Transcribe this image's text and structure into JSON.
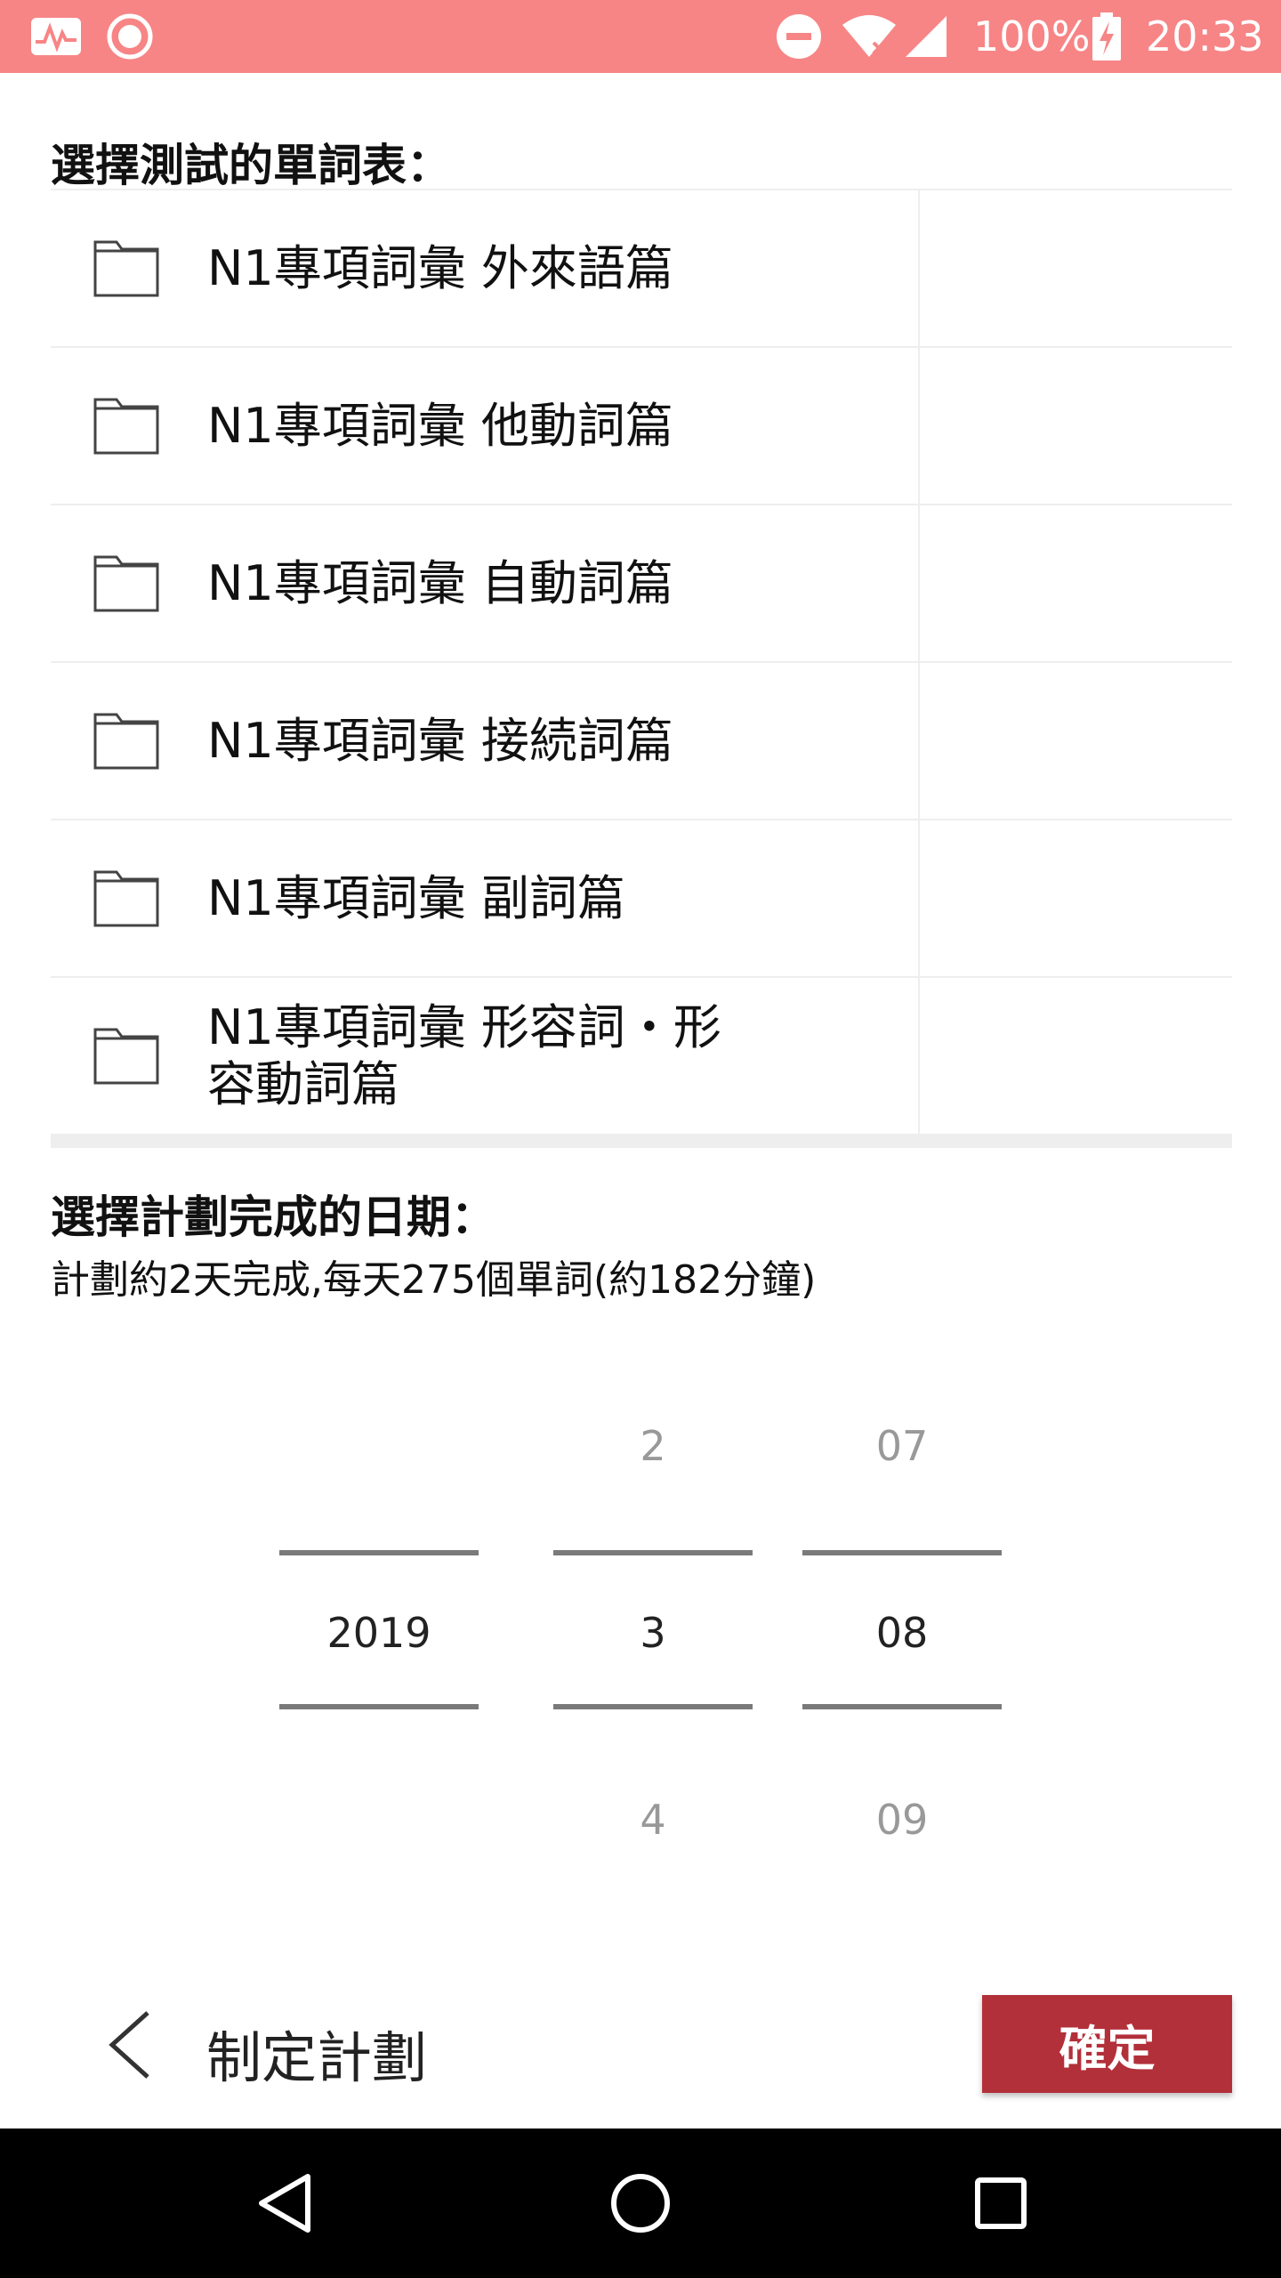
{
  "status_bar": {
    "battery": "100%",
    "time": "20:33",
    "icons": [
      "activity-icon",
      "record-icon",
      "do-not-disturb-icon",
      "wifi-icon",
      "cell-signal-icon",
      "battery-charging-icon"
    ]
  },
  "word_list": {
    "title": "選擇測試的單詞表：",
    "items": [
      {
        "label": "N1專項詞彙 外來語篇",
        "icon": "folder-icon"
      },
      {
        "label": "N1專項詞彙 他動詞篇",
        "icon": "folder-icon"
      },
      {
        "label": "N1專項詞彙 自動詞篇",
        "icon": "folder-icon"
      },
      {
        "label": "N1專項詞彙 接続詞篇",
        "icon": "folder-icon"
      },
      {
        "label": "N1專項詞彙 副詞篇",
        "icon": "folder-icon"
      },
      {
        "label": "N1專項詞彙 形容詞・形容動詞篇",
        "icon": "folder-icon"
      }
    ]
  },
  "plan_date": {
    "title": "選擇計劃完成的日期：",
    "summary": "計劃約2天完成,每天275個單詞(約182分鐘)"
  },
  "date_picker": {
    "year": {
      "selected": "2019"
    },
    "month": {
      "prev": "2",
      "selected": "3",
      "next": "4"
    },
    "day": {
      "prev": "07",
      "selected": "08",
      "next": "09"
    }
  },
  "action_bar": {
    "title": "制定計劃",
    "confirm_label": "確定",
    "accent_color": "#b2303a"
  },
  "nav_bar": {
    "icons": [
      "back-triangle-icon",
      "home-circle-icon",
      "recents-square-icon"
    ]
  }
}
